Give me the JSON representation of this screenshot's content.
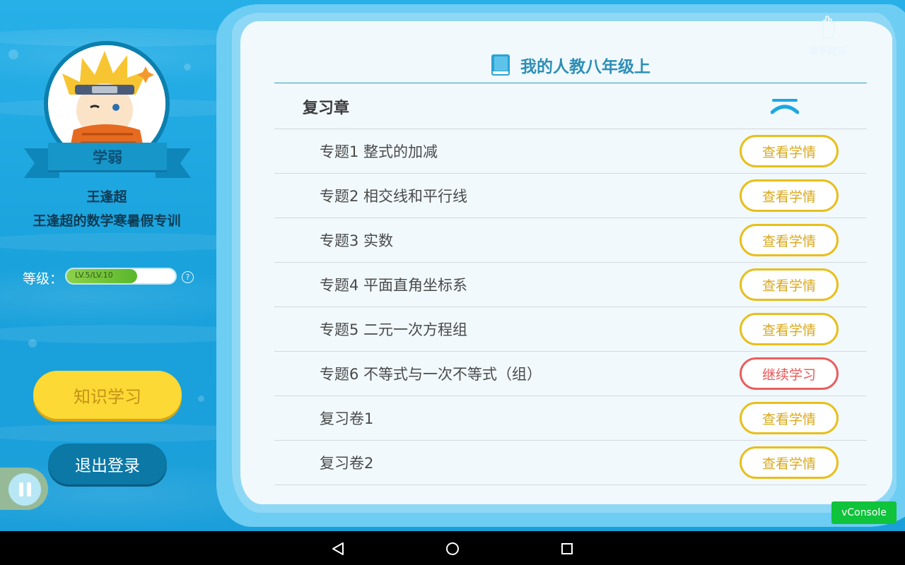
{
  "header": {
    "title": "我的人教八年级上",
    "icon": "book-icon"
  },
  "raise_hand": {
    "label": "举手提问",
    "icon": "hand-icon"
  },
  "chapter": {
    "title": "复习章",
    "icon": "chevron-up-icon"
  },
  "topics": [
    {
      "title": "专题1 整式的加减",
      "action": "查看学情",
      "status": "done"
    },
    {
      "title": "专题2 相交线和平行线",
      "action": "查看学情",
      "status": "done"
    },
    {
      "title": "专题3 实数",
      "action": "查看学情",
      "status": "done"
    },
    {
      "title": "专题4 平面直角坐标系",
      "action": "查看学情",
      "status": "done"
    },
    {
      "title": "专题5 二元一次方程组",
      "action": "查看学情",
      "status": "done"
    },
    {
      "title": "专题6 不等式与一次不等式（组）",
      "action": "继续学习",
      "status": "in-progress"
    },
    {
      "title": "复习卷1",
      "action": "查看学情",
      "status": "done"
    },
    {
      "title": "复习卷2",
      "action": "查看学情",
      "status": "done"
    }
  ],
  "profile": {
    "badge": "学弱",
    "name": "王逢超",
    "course": "王逢超的数学寒暑假专训",
    "level_label": "等级：",
    "level_text": "LV.5/LV.10",
    "level_progress": 0.65,
    "help_icon": "?"
  },
  "buttons": {
    "study": "知识学习",
    "logout": "退出登录"
  },
  "vconsole": "vConsole",
  "colors": {
    "accent": "#2d8fb5",
    "pill_yellow": "#e8bf1a",
    "pill_red": "#ea5e5e",
    "study_button": "#fdd935",
    "logout_button": "#0b78a6"
  }
}
